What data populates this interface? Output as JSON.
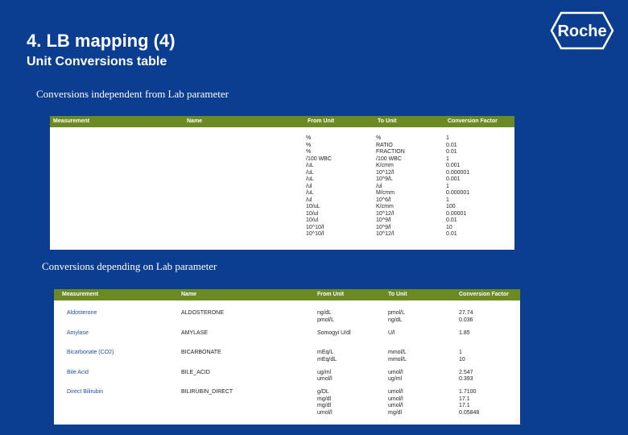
{
  "header": {
    "title": "4. LB mapping (4)",
    "subtitle": "Unit Conversions table",
    "logo_text": "Roche"
  },
  "section1": {
    "label": "Conversions independent from Lab parameter",
    "columns": [
      "Measurement",
      "Name",
      "From Unit",
      "To Unit",
      "Conversion Factor"
    ],
    "rows": [
      {
        "from": "%",
        "to": "%",
        "factor": "1"
      },
      {
        "from": "%",
        "to": "RATIO",
        "factor": "0.01"
      },
      {
        "from": "%",
        "to": "FRACTION",
        "factor": "0.01"
      },
      {
        "from": "/100 WBC",
        "to": "/100 WBC",
        "factor": "1"
      },
      {
        "from": "/uL",
        "to": "K/cmm",
        "factor": "0.001"
      },
      {
        "from": "/uL",
        "to": "10^12/l",
        "factor": "0.000001"
      },
      {
        "from": "/uL",
        "to": "10^9/L",
        "factor": "0.001"
      },
      {
        "from": "/ul",
        "to": "/ul",
        "factor": "1"
      },
      {
        "from": "/uL",
        "to": "M/cmm",
        "factor": "0.000001"
      },
      {
        "from": "/ul",
        "to": "10^6/l",
        "factor": "1"
      },
      {
        "from": "10/uL",
        "to": "K/cmm",
        "factor": "100"
      },
      {
        "from": "10/ul",
        "to": "10^12/l",
        "factor": "0.00001"
      },
      {
        "from": "10/ul",
        "to": "10^9/l",
        "factor": "0.01"
      },
      {
        "from": "10^10/l",
        "to": "10^9/l",
        "factor": "10"
      },
      {
        "from": "10^10/l",
        "to": "10^12/l",
        "factor": "0.01"
      }
    ]
  },
  "section2": {
    "label": "Conversions depending on Lab parameter",
    "columns": [
      "Measurement",
      "Name",
      "From Unit",
      "To Unit",
      "Conversion Factor"
    ],
    "groups": [
      {
        "measurement": "Aldosterone",
        "name": "ALDOSTERONE",
        "from": "ng/dL\npmol/L",
        "to": "pmol/L\nng/dL",
        "factor": "27.74\n0.036"
      },
      {
        "measurement": "Amylase",
        "name": "AMYLASE",
        "from": "Somogyi U/dl",
        "to": "U/l",
        "factor": "1.85"
      },
      {
        "measurement": "Bicarbonate (CO2)",
        "name": "BICARBONATE",
        "from": "mEq/L\nmEq/dL",
        "to": "mmol/L\nmmol/L",
        "factor": "1\n10"
      },
      {
        "measurement": "Bile Acid",
        "name": "BILE_ACID",
        "from": "ug/ml\numol/l",
        "to": "umol/l\nug/ml",
        "factor": "2.547\n0.393"
      },
      {
        "measurement": "Direct Bilirubin",
        "name": "BILIRUBIN_DIRECT",
        "from": "g/DL\nmg/dl\nmg/dl\numol/l",
        "to": "umol/l\numol/l\numol/l\nmg/dl",
        "factor": "1.7100\n17.1\n17.1\n0.05848"
      }
    ]
  }
}
